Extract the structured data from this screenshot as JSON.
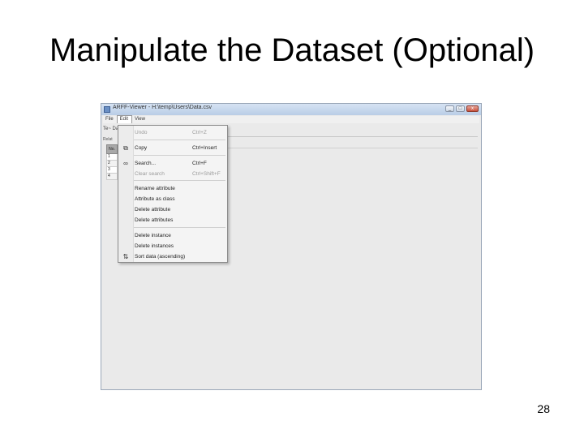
{
  "slide": {
    "title": "Manipulate the Dataset (Optional)",
    "page_number": "28"
  },
  "window": {
    "title": "ARFF-Viewer - H:\\temp\\Users\\Data.csv",
    "controls": [
      "_",
      "□",
      "x"
    ]
  },
  "menubar": [
    "File",
    "Edit",
    "View"
  ],
  "toolbar": {
    "left_label": "Te~ Data",
    "relation_label": "Relat"
  },
  "grid": {
    "header": "No.",
    "rows": [
      "1",
      "2",
      "3",
      "4"
    ]
  },
  "edit_menu": {
    "items": [
      {
        "label": "Undo",
        "shortcut": "Ctrl+Z",
        "enabled": false,
        "icon": ""
      },
      {
        "label": "Copy",
        "shortcut": "Ctrl+Insert",
        "enabled": true,
        "icon": "copy-icon"
      },
      {
        "label": "Search...",
        "shortcut": "Ctrl+F",
        "enabled": true,
        "icon": "binoculars-icon"
      },
      {
        "label": "Clear search",
        "shortcut": "Ctrl+Shift+F",
        "enabled": false,
        "icon": ""
      },
      {
        "label": "Rename attribute",
        "shortcut": "",
        "enabled": true,
        "icon": ""
      },
      {
        "label": "Attribute as class",
        "shortcut": "",
        "enabled": true,
        "icon": ""
      },
      {
        "label": "Delete attribute",
        "shortcut": "",
        "enabled": true,
        "icon": ""
      },
      {
        "label": "Delete attributes",
        "shortcut": "",
        "enabled": true,
        "icon": ""
      },
      {
        "label": "Delete instance",
        "shortcut": "",
        "enabled": true,
        "icon": ""
      },
      {
        "label": "Delete instances",
        "shortcut": "",
        "enabled": true,
        "icon": ""
      },
      {
        "label": "Sort data (ascending)",
        "shortcut": "",
        "enabled": true,
        "icon": "sort-az-icon"
      }
    ]
  }
}
